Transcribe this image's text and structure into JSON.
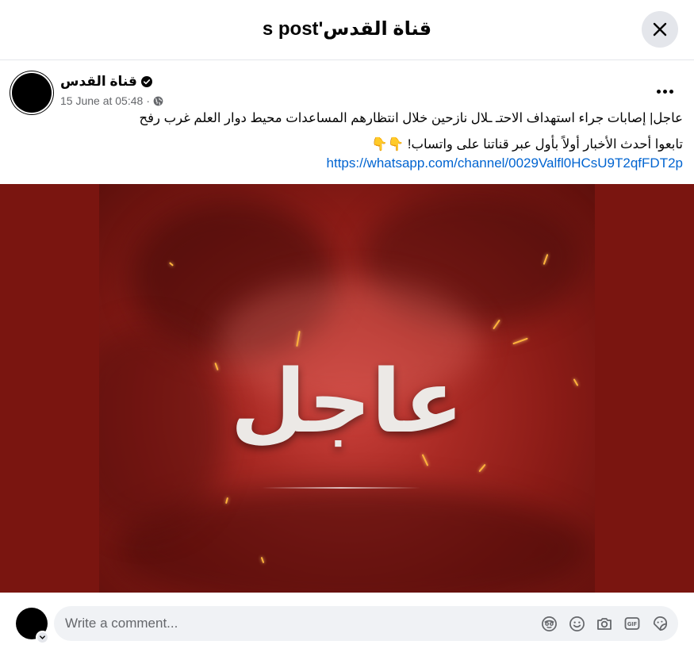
{
  "header": {
    "title": "قناة القدس's post"
  },
  "post": {
    "page_name": "قناة القدس",
    "time": "15 June at 05:48",
    "separator": "·",
    "text_line1": "عاجل| إصابات جراء استهداف الاحتـ ـلال نازحين خلال انتظارهم المساعدات محيط دوار العلم غرب رفح",
    "text_line2": "تابعوا أحدث الأخبار أولاً بأول عبر قناتنا على واتساب! 👇👇",
    "link": "https://whatsapp.com/channel/0029Valfl0HCsU9T2qfFDT2p",
    "image_text": "عاجل"
  },
  "comment": {
    "placeholder": "Write a comment..."
  },
  "colors": {
    "accent": "#0064d1",
    "media_bg": "#7a1510",
    "input_bg": "#f0f2f5"
  },
  "icons": [
    "close-icon",
    "verified-icon",
    "globe-icon",
    "more-icon",
    "avatar-sticker-icon",
    "emoji-icon",
    "camera-icon",
    "gif-icon",
    "sticker-icon",
    "chevron-down-icon"
  ]
}
